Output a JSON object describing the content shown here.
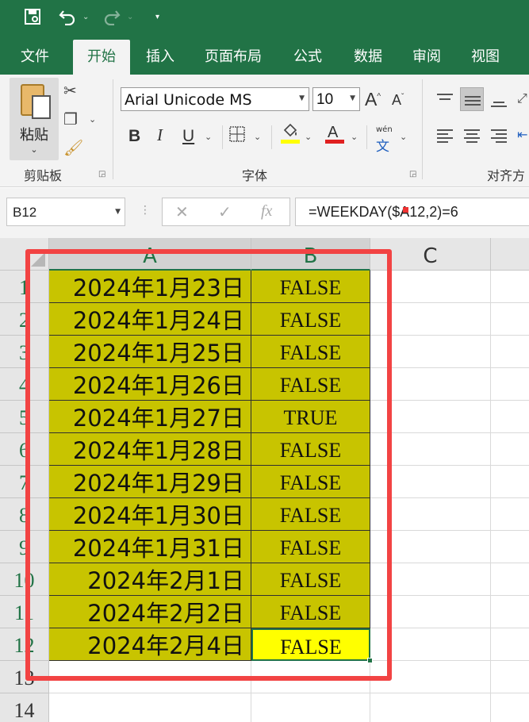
{
  "toolbar": {
    "save_icon": "save-icon",
    "undo_icon": "undo-icon",
    "redo_icon": "redo-icon"
  },
  "tabs": [
    "文件",
    "开始",
    "插入",
    "页面布局",
    "公式",
    "数据",
    "审阅",
    "视图"
  ],
  "ribbon": {
    "paste_label": "粘贴",
    "clipboard_group": "剪贴板",
    "font_group": "字体",
    "align_group": "对齐方",
    "font_name": "Arial Unicode MS",
    "font_size": "10",
    "bold_label": "B",
    "italic_label": "I",
    "underline_label": "U",
    "grow_label": "A",
    "shrink_label": "A",
    "font_color_label": "A",
    "phonetic_label": "wén",
    "phonetic_char": "文",
    "fill_color": "#ffff00",
    "font_color": "#e02020"
  },
  "formula_bar": {
    "name_box": "B12",
    "formula": "=WEEKDAY($A12,2)=6"
  },
  "sheet": {
    "columns": [
      "A",
      "B",
      "C"
    ],
    "row_numbers": [
      "1",
      "2",
      "3",
      "4",
      "5",
      "6",
      "7",
      "8",
      "9",
      "10",
      "11",
      "12",
      "13",
      "14"
    ],
    "rows": [
      {
        "a": "2024年1月23日",
        "b": "FALSE"
      },
      {
        "a": "2024年1月24日",
        "b": "FALSE"
      },
      {
        "a": "2024年1月25日",
        "b": "FALSE"
      },
      {
        "a": "2024年1月26日",
        "b": "FALSE"
      },
      {
        "a": "2024年1月27日",
        "b": "TRUE"
      },
      {
        "a": "2024年1月28日",
        "b": "FALSE"
      },
      {
        "a": "2024年1月29日",
        "b": "FALSE"
      },
      {
        "a": "2024年1月30日",
        "b": "FALSE"
      },
      {
        "a": "2024年1月31日",
        "b": "FALSE"
      },
      {
        "a": "2024年2月1日",
        "b": "FALSE"
      },
      {
        "a": "2024年2月2日",
        "b": "FALSE"
      },
      {
        "a": "2024年2月4日",
        "b": "FALSE"
      }
    ],
    "fill_color": "#c8c400",
    "active_fill": "#ffff00",
    "accent": "#217346",
    "highlight_color": "#f24343"
  }
}
